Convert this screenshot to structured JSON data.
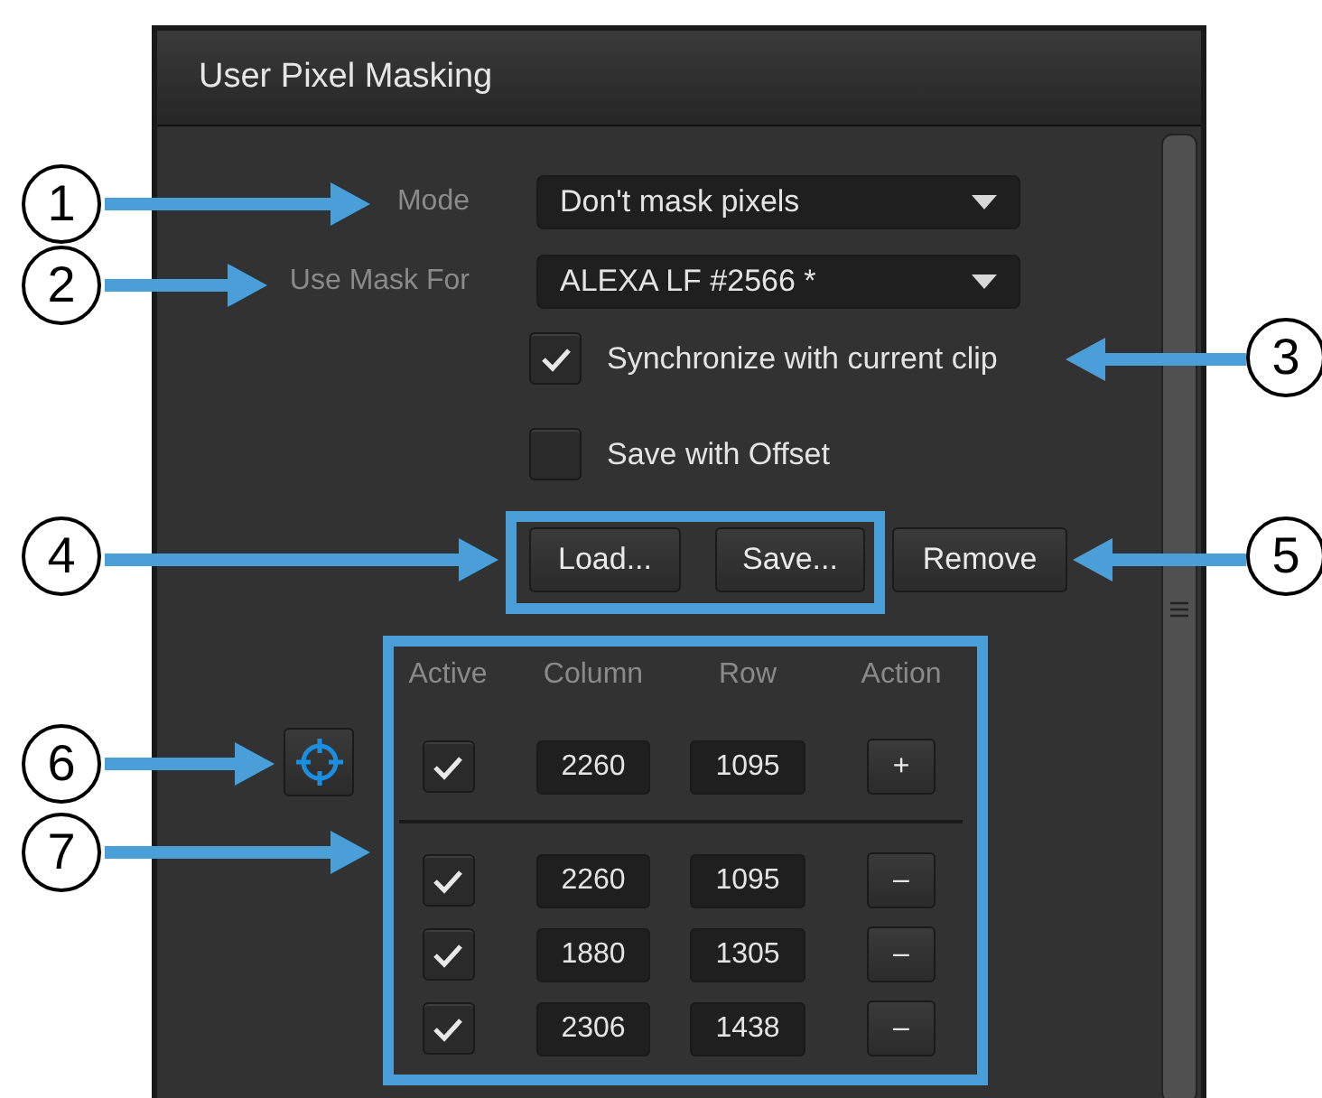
{
  "panel": {
    "title": "User Pixel Masking"
  },
  "mode": {
    "label": "Mode",
    "value": "Don't mask pixels"
  },
  "use_mask_for": {
    "label": "Use Mask For",
    "value": "ALEXA LF #2566 *"
  },
  "checkboxes": [
    {
      "label": "Synchronize with current clip",
      "checked": true
    },
    {
      "label": "Save with Offset",
      "checked": false
    }
  ],
  "buttons": [
    "Load...",
    "Save...",
    "Remove"
  ],
  "table": {
    "columns": [
      "Active",
      "Column",
      "Row",
      "Action"
    ],
    "new_entry": {
      "active": true,
      "column": "2260",
      "row": "1095",
      "action": "+"
    },
    "rows": [
      {
        "active": true,
        "column": "2260",
        "row": "1095",
        "action": "–"
      },
      {
        "active": true,
        "column": "1880",
        "row": "1305",
        "action": "–"
      },
      {
        "active": true,
        "column": "2306",
        "row": "1438",
        "action": "–"
      }
    ]
  },
  "callouts": [
    {
      "label": "1"
    },
    {
      "label": "2"
    },
    {
      "label": "3"
    },
    {
      "label": "4"
    },
    {
      "label": "5"
    },
    {
      "label": "6"
    },
    {
      "label": "7"
    }
  ]
}
